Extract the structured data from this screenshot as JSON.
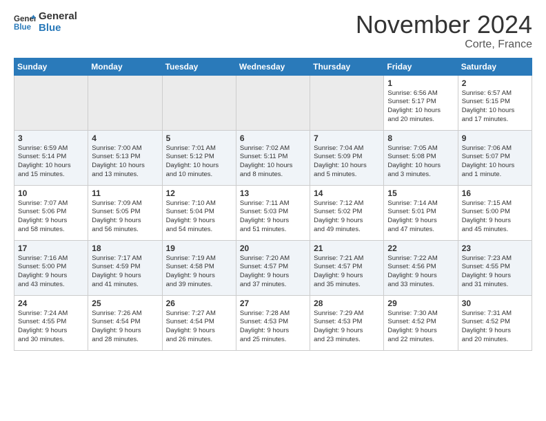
{
  "header": {
    "logo_line1": "General",
    "logo_line2": "Blue",
    "month": "November 2024",
    "location": "Corte, France"
  },
  "weekdays": [
    "Sunday",
    "Monday",
    "Tuesday",
    "Wednesday",
    "Thursday",
    "Friday",
    "Saturday"
  ],
  "weeks": [
    [
      {
        "day": "",
        "info": ""
      },
      {
        "day": "",
        "info": ""
      },
      {
        "day": "",
        "info": ""
      },
      {
        "day": "",
        "info": ""
      },
      {
        "day": "",
        "info": ""
      },
      {
        "day": "1",
        "info": "Sunrise: 6:56 AM\nSunset: 5:17 PM\nDaylight: 10 hours\nand 20 minutes."
      },
      {
        "day": "2",
        "info": "Sunrise: 6:57 AM\nSunset: 5:15 PM\nDaylight: 10 hours\nand 17 minutes."
      }
    ],
    [
      {
        "day": "3",
        "info": "Sunrise: 6:59 AM\nSunset: 5:14 PM\nDaylight: 10 hours\nand 15 minutes."
      },
      {
        "day": "4",
        "info": "Sunrise: 7:00 AM\nSunset: 5:13 PM\nDaylight: 10 hours\nand 13 minutes."
      },
      {
        "day": "5",
        "info": "Sunrise: 7:01 AM\nSunset: 5:12 PM\nDaylight: 10 hours\nand 10 minutes."
      },
      {
        "day": "6",
        "info": "Sunrise: 7:02 AM\nSunset: 5:11 PM\nDaylight: 10 hours\nand 8 minutes."
      },
      {
        "day": "7",
        "info": "Sunrise: 7:04 AM\nSunset: 5:09 PM\nDaylight: 10 hours\nand 5 minutes."
      },
      {
        "day": "8",
        "info": "Sunrise: 7:05 AM\nSunset: 5:08 PM\nDaylight: 10 hours\nand 3 minutes."
      },
      {
        "day": "9",
        "info": "Sunrise: 7:06 AM\nSunset: 5:07 PM\nDaylight: 10 hours\nand 1 minute."
      }
    ],
    [
      {
        "day": "10",
        "info": "Sunrise: 7:07 AM\nSunset: 5:06 PM\nDaylight: 9 hours\nand 58 minutes."
      },
      {
        "day": "11",
        "info": "Sunrise: 7:09 AM\nSunset: 5:05 PM\nDaylight: 9 hours\nand 56 minutes."
      },
      {
        "day": "12",
        "info": "Sunrise: 7:10 AM\nSunset: 5:04 PM\nDaylight: 9 hours\nand 54 minutes."
      },
      {
        "day": "13",
        "info": "Sunrise: 7:11 AM\nSunset: 5:03 PM\nDaylight: 9 hours\nand 51 minutes."
      },
      {
        "day": "14",
        "info": "Sunrise: 7:12 AM\nSunset: 5:02 PM\nDaylight: 9 hours\nand 49 minutes."
      },
      {
        "day": "15",
        "info": "Sunrise: 7:14 AM\nSunset: 5:01 PM\nDaylight: 9 hours\nand 47 minutes."
      },
      {
        "day": "16",
        "info": "Sunrise: 7:15 AM\nSunset: 5:00 PM\nDaylight: 9 hours\nand 45 minutes."
      }
    ],
    [
      {
        "day": "17",
        "info": "Sunrise: 7:16 AM\nSunset: 5:00 PM\nDaylight: 9 hours\nand 43 minutes."
      },
      {
        "day": "18",
        "info": "Sunrise: 7:17 AM\nSunset: 4:59 PM\nDaylight: 9 hours\nand 41 minutes."
      },
      {
        "day": "19",
        "info": "Sunrise: 7:19 AM\nSunset: 4:58 PM\nDaylight: 9 hours\nand 39 minutes."
      },
      {
        "day": "20",
        "info": "Sunrise: 7:20 AM\nSunset: 4:57 PM\nDaylight: 9 hours\nand 37 minutes."
      },
      {
        "day": "21",
        "info": "Sunrise: 7:21 AM\nSunset: 4:57 PM\nDaylight: 9 hours\nand 35 minutes."
      },
      {
        "day": "22",
        "info": "Sunrise: 7:22 AM\nSunset: 4:56 PM\nDaylight: 9 hours\nand 33 minutes."
      },
      {
        "day": "23",
        "info": "Sunrise: 7:23 AM\nSunset: 4:55 PM\nDaylight: 9 hours\nand 31 minutes."
      }
    ],
    [
      {
        "day": "24",
        "info": "Sunrise: 7:24 AM\nSunset: 4:55 PM\nDaylight: 9 hours\nand 30 minutes."
      },
      {
        "day": "25",
        "info": "Sunrise: 7:26 AM\nSunset: 4:54 PM\nDaylight: 9 hours\nand 28 minutes."
      },
      {
        "day": "26",
        "info": "Sunrise: 7:27 AM\nSunset: 4:54 PM\nDaylight: 9 hours\nand 26 minutes."
      },
      {
        "day": "27",
        "info": "Sunrise: 7:28 AM\nSunset: 4:53 PM\nDaylight: 9 hours\nand 25 minutes."
      },
      {
        "day": "28",
        "info": "Sunrise: 7:29 AM\nSunset: 4:53 PM\nDaylight: 9 hours\nand 23 minutes."
      },
      {
        "day": "29",
        "info": "Sunrise: 7:30 AM\nSunset: 4:52 PM\nDaylight: 9 hours\nand 22 minutes."
      },
      {
        "day": "30",
        "info": "Sunrise: 7:31 AM\nSunset: 4:52 PM\nDaylight: 9 hours\nand 20 minutes."
      }
    ]
  ]
}
